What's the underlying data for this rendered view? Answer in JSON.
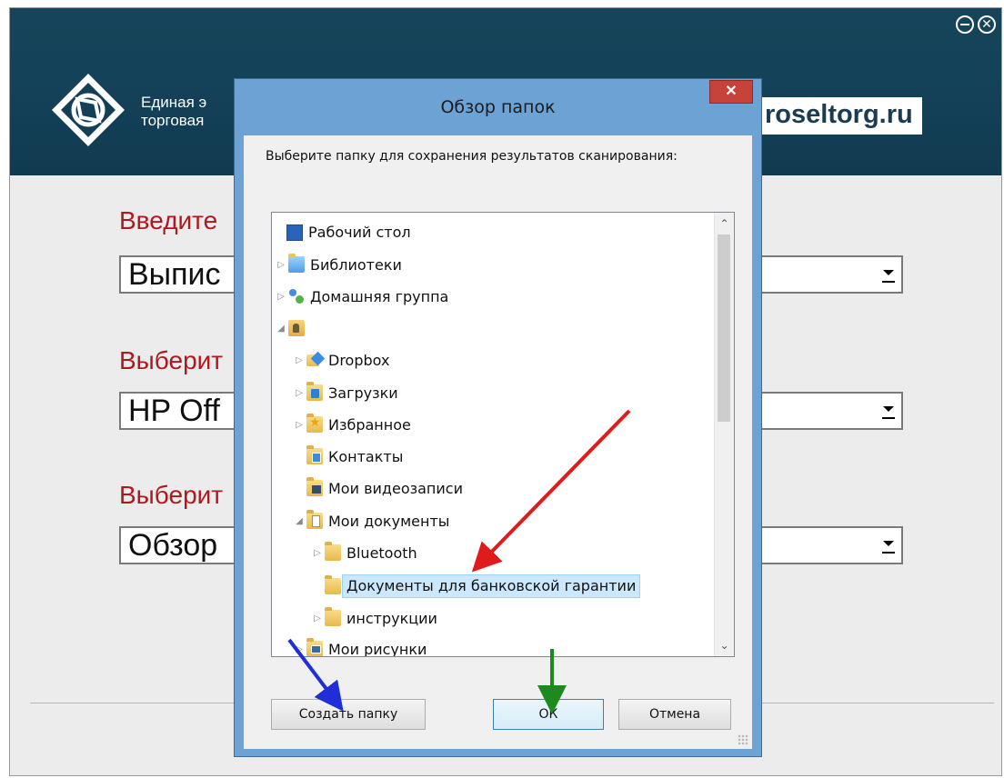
{
  "app": {
    "brand_line1": "Единая э",
    "brand_line2": "торговая",
    "site": "roseltorg.ru",
    "minimize_glyph": "−",
    "close_glyph": "⊗",
    "prompt1": "Введите",
    "combo1_value": "Выпис",
    "prompt2": "Выберит",
    "combo2_value": "HP Off",
    "prompt3": "Выберит",
    "combo3_value": "Обзор"
  },
  "dialog": {
    "title": "Обзор папок",
    "close_glyph": "✕",
    "description": "Выберите папку для сохранения результатов сканирования:",
    "tree": [
      {
        "label": "Рабочий стол",
        "icon": "desktop-icon",
        "expander": ""
      },
      {
        "label": "Библиотеки",
        "icon": "libraries-icon",
        "expander": "▷"
      },
      {
        "label": "Домашняя группа",
        "icon": "homegroup-icon",
        "expander": "▷"
      },
      {
        "label": "",
        "icon": "user-folder-icon",
        "expander": "◢"
      },
      {
        "label": "Dropbox",
        "icon": "dropbox-icon",
        "expander": "▷"
      },
      {
        "label": "Загрузки",
        "icon": "downloads-folder-icon",
        "expander": "▷"
      },
      {
        "label": "Избранное",
        "icon": "favorites-folder-icon",
        "expander": "▷"
      },
      {
        "label": "Контакты",
        "icon": "contacts-folder-icon",
        "expander": ""
      },
      {
        "label": "Мои видеозаписи",
        "icon": "videos-folder-icon",
        "expander": ""
      },
      {
        "label": "Мои документы",
        "icon": "documents-folder-icon",
        "expander": "◢"
      },
      {
        "label": "Bluetooth",
        "icon": "folder-icon",
        "expander": "▷"
      },
      {
        "label": "Документы для банковской гарантии",
        "icon": "folder-icon",
        "expander": "",
        "selected": true
      },
      {
        "label": "инструкции",
        "icon": "folder-icon",
        "expander": "▷"
      },
      {
        "label": "Мои рисунки",
        "icon": "pictures-folder-icon",
        "expander": "▷"
      }
    ],
    "scroll_up_glyph": "⌃",
    "scroll_down_glyph": "⌄",
    "new_folder_label": "Создать папку",
    "ok_label": "ОК",
    "cancel_label": "Отмена"
  },
  "colors": {
    "header_bg": "#134057",
    "dialog_frame": "#6ca2d4",
    "prompt_red": "#b01820",
    "arrow_red": "#e01b1b",
    "arrow_blue": "#1f2ed6",
    "arrow_green": "#1d8a1d"
  }
}
